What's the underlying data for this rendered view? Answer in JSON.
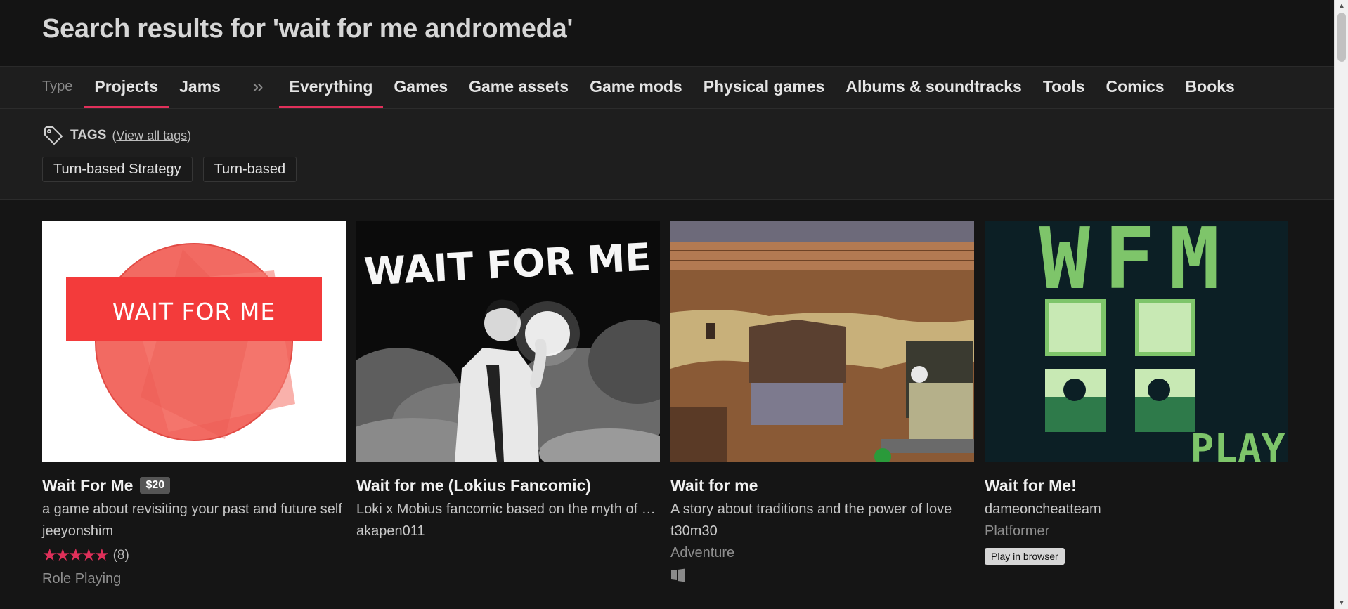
{
  "header": {
    "title": "Search results for 'wait for me andromeda'"
  },
  "type_nav": {
    "type_label": "Type",
    "types": [
      {
        "label": "Projects",
        "active": true
      },
      {
        "label": "Jams",
        "active": false
      }
    ],
    "separator": "»",
    "categories": [
      {
        "label": "Everything",
        "active": true
      },
      {
        "label": "Games"
      },
      {
        "label": "Game assets"
      },
      {
        "label": "Game mods"
      },
      {
        "label": "Physical games"
      },
      {
        "label": "Albums & soundtracks"
      },
      {
        "label": "Tools"
      },
      {
        "label": "Comics"
      },
      {
        "label": "Books"
      }
    ]
  },
  "tags": {
    "title": "TAGS",
    "view_all_open": "(",
    "view_all": "View all tags",
    "view_all_close": ")",
    "chips": [
      "Turn-based Strategy",
      "Turn-based"
    ]
  },
  "results": [
    {
      "title": "Wait For Me",
      "price": "$20",
      "thumbnail_text": "WAIT FOR ME",
      "description": "a game about revisiting your past and future self",
      "author": "jeeyonshim",
      "rating_stars": 5,
      "rating_stars_text": "★★★★★",
      "rating_count": "(8)",
      "genre": "Role Playing"
    },
    {
      "title": "Wait for me (Lokius Fancomic)",
      "thumbnail_text": "WAIT FOR ME",
      "description": "Loki x Mobius fancomic based on the myth of Orpheus",
      "author": "akapen011"
    },
    {
      "title": "Wait for me",
      "description": "A story about traditions and the power of love",
      "author": "t30m30",
      "genre": "Adventure",
      "platform_icon": "windows-icon"
    },
    {
      "title": "Wait for Me!",
      "thumbnail_text": "WFM",
      "thumbnail_text_2": "PLAY",
      "author": "dameoncheatteam",
      "genre": "Platformer",
      "play_button": "Play in browser"
    }
  ],
  "colors": {
    "accent": "#e0305a",
    "background": "#151515",
    "panel": "#1e1e1e"
  }
}
